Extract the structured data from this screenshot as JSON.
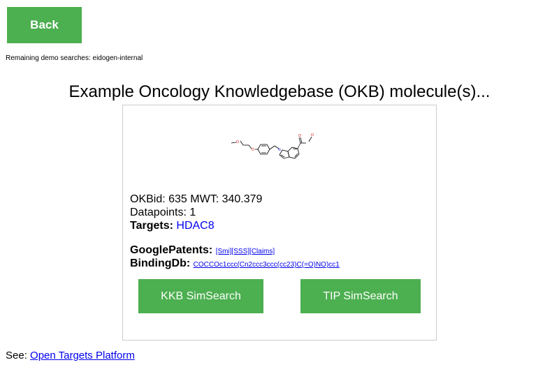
{
  "header": {
    "back_label": "Back",
    "remaining_text": "Remaining demo searches: eidogen-internal"
  },
  "title": "Example Oncology Knowledgebase (OKB) molecule(s)...",
  "molecule": {
    "okbid_text": "OKBid: 635 MWT: 340.379",
    "datapoints_text": "Datapoints: 1",
    "targets_label": "Targets:",
    "target_value": "HDAC8",
    "google_patents_label": "GooglePatents:",
    "google_patents_links": [
      "[Smi]",
      "[SSS]",
      "[Claims]"
    ],
    "bindingdb_label": "BindingDb:",
    "bindingdb_smiles": "COCCOc1ccc(Cn2ccc3ccc(cc23)C(=O)NO)cc1",
    "structure_atoms": [
      "O",
      "O",
      "N",
      "O",
      "O"
    ]
  },
  "buttons": {
    "kkb_label": "KKB SimSearch",
    "tip_label": "TIP SimSearch"
  },
  "footer": {
    "see_label": "See:",
    "link_label": "Open Targets Platform"
  },
  "colors": {
    "button_green": "#4caf50",
    "link_blue": "#0000ee",
    "card_border": "#cccccc"
  }
}
